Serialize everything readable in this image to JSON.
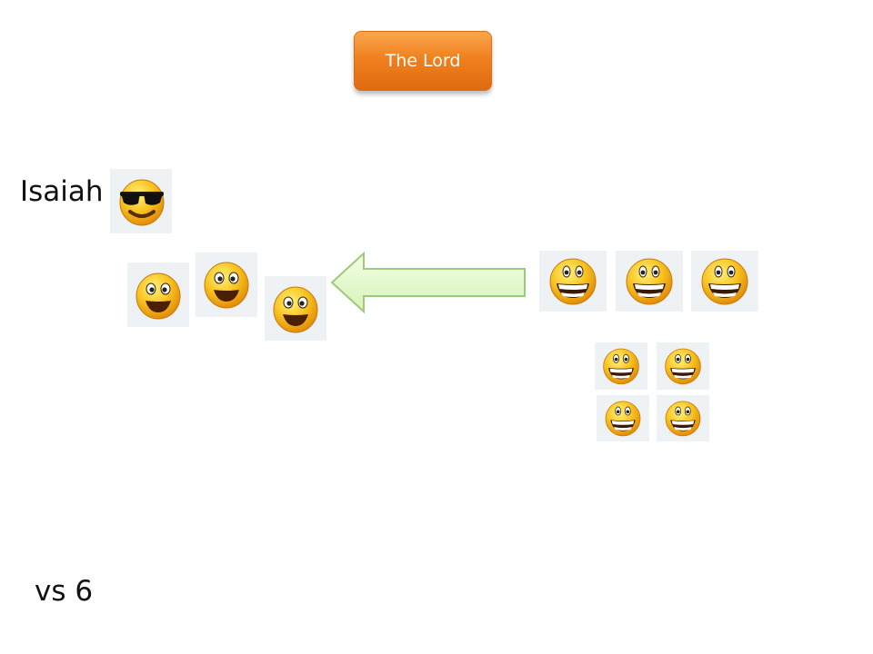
{
  "the_lord_label": "The Lord",
  "isaiah_label": "Isaiah",
  "verse_label": "vs 6",
  "icons": {
    "isaiah": "sunglasses-smiley-icon",
    "left_group": "open-smile-icon",
    "right_group": "grinning-smiley-icon",
    "arrow": "left-arrow-icon"
  },
  "colors": {
    "button_orange": "#f0811f",
    "arrow_fill": "#e0f8c8",
    "arrow_stroke": "#9cc97a",
    "face_yellow": "#f6b81a"
  }
}
